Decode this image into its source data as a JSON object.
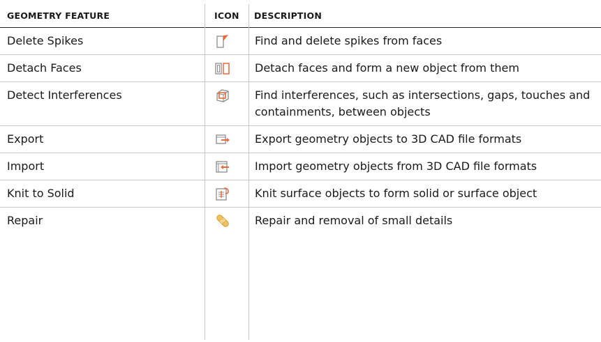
{
  "table": {
    "headers": {
      "feature": "GEOMETRY FEATURE",
      "icon": "ICON",
      "description": "DESCRIPTION"
    },
    "rows": [
      {
        "feature": "Delete Spikes",
        "icon": "delete-spikes-icon",
        "description": "Find and delete spikes from faces"
      },
      {
        "feature": "Detach Faces",
        "icon": "detach-faces-icon",
        "description": "Detach faces and form a new object from them"
      },
      {
        "feature": "Detect Interferences",
        "icon": "detect-interferences-icon",
        "description": "Find interferences, such as intersections, gaps, touches and containments, between objects"
      },
      {
        "feature": "Export",
        "icon": "export-icon",
        "description": "Export geometry objects to 3D CAD file formats"
      },
      {
        "feature": "Import",
        "icon": "import-icon",
        "description": "Import geometry objects from 3D CAD file formats"
      },
      {
        "feature": "Knit to Solid",
        "icon": "knit-to-solid-icon",
        "description": "Knit surface objects to form solid or surface object"
      },
      {
        "feature": "Repair",
        "icon": "repair-icon",
        "description": "Repair and removal of small details"
      }
    ]
  },
  "colors": {
    "accent_orange": "#e8693a",
    "icon_gray": "#8c8c8c",
    "bandage": "#e8b840"
  }
}
